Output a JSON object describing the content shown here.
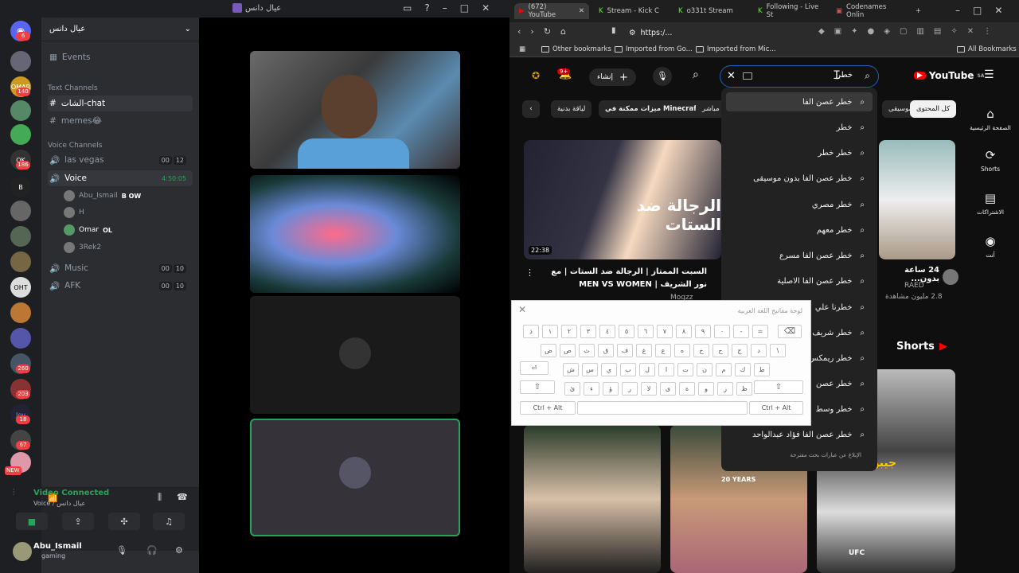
{
  "discord": {
    "window_title": "عيال دانس",
    "guild_name": "عيال دانس",
    "server_badges": [
      "6",
      "140",
      "186",
      "260",
      "203",
      "18",
      "67",
      "NEW"
    ],
    "events_label": "Events",
    "text_channels_label": "Text Channels",
    "text_channels": [
      "الشات-chat",
      "memes😂"
    ],
    "voice_channels_label": "Voice Channels",
    "voice_channels": [
      {
        "name": "las vegas",
        "counts": [
          "00",
          "12"
        ]
      },
      {
        "name": "Voice",
        "timer": "4:50:05"
      },
      {
        "name": "Music",
        "counts": [
          "00",
          "10"
        ]
      },
      {
        "name": "AFK",
        "counts": [
          "00",
          "10"
        ]
      }
    ],
    "voice_users": [
      {
        "name": "Abu_Ismail",
        "tag": "B OW"
      },
      {
        "name": "H",
        "tag": ""
      },
      {
        "name": "Omar",
        "tag": "OL"
      },
      {
        "name": "3Rek2",
        "tag": "×."
      }
    ],
    "voice_status": "Video Connected",
    "voice_status_sub": "Voice / عيال دانس",
    "current_user": "Abu_Ismail",
    "current_user_status": "gaming"
  },
  "browser": {
    "tabs": [
      {
        "label": "(672) YouTube",
        "active": true
      },
      {
        "label": "Stream - Kick C"
      },
      {
        "label": "o331t Stream"
      },
      {
        "label": "Following - Live St"
      },
      {
        "label": "Codenames Onlin"
      }
    ],
    "url": "https:/...",
    "bookmarks": [
      "Other bookmarks",
      "Imported from Go...",
      "Imported from Mic...",
      "All Bookmarks"
    ]
  },
  "youtube": {
    "search_value": "خطر",
    "logo_text": "YouTube",
    "region": "SA",
    "notif_count": "9+",
    "create_label": "إنشاء",
    "chips": [
      "كل المحتوى",
      "موسيقى",
      "مباشر",
      "ميزات ممكنة في Minecraft",
      "لياقة بدنية"
    ],
    "suggestions": [
      "خطر عصن الفا",
      "خطر",
      "خطر خطر",
      "خطر عصن الفا بدون موسيقى",
      "خطر مصري",
      "خطر معهم",
      "خطر عصن الفا مسرع",
      "خطر عصن الفا الاصلية",
      "خطرنا علي",
      "خطر شريف",
      "خطر ريمكس",
      "خطر عصن",
      "خطر وسط",
      "خطر عصن الفا فؤاد عبدالواحد"
    ],
    "report_text": "الإبلاغ عن عبارات بحث مقترحة",
    "video1": {
      "title": "السبت الممتاز | الرجالة ضد الستات | مع نور الشريف | MEN VS WOMEN",
      "channel": "Moqzz",
      "duration": "22:38",
      "thumb_text": "الرجالة ضد الستات"
    },
    "video2": {
      "title": "24 ساعة بدون...",
      "channel": "RAED",
      "views": "2.8 مليون مشاهدة"
    },
    "shorts_label": "Shorts",
    "sidebar": [
      "الصفحة الرئيسية",
      "Shorts",
      "الاشتراكات",
      "أنت"
    ],
    "short_labels": [
      "20 YEARS",
      "جيبوانس",
      "UFC"
    ]
  },
  "keyboard": {
    "title": "لوحة مفاتيح اللغة العربية",
    "rows": [
      [
        "ذ",
        "١",
        "٢",
        "٣",
        "٤",
        "٥",
        "٦",
        "٧",
        "٨",
        "٩",
        "٠",
        "-",
        "="
      ],
      [
        "ض",
        "ص",
        "ث",
        "ق",
        "ف",
        "غ",
        "ع",
        "ه",
        "خ",
        "ح",
        "ج",
        "د",
        "\\"
      ],
      [
        "ش",
        "س",
        "ي",
        "ب",
        "ل",
        "ا",
        "ت",
        "ن",
        "م",
        "ك",
        "ط"
      ],
      [
        "ئ",
        "ء",
        "ؤ",
        "ر",
        "لا",
        "ى",
        "ة",
        "و",
        "ز",
        "ظ"
      ]
    ],
    "ctrl_alt": "Ctrl + Alt"
  }
}
